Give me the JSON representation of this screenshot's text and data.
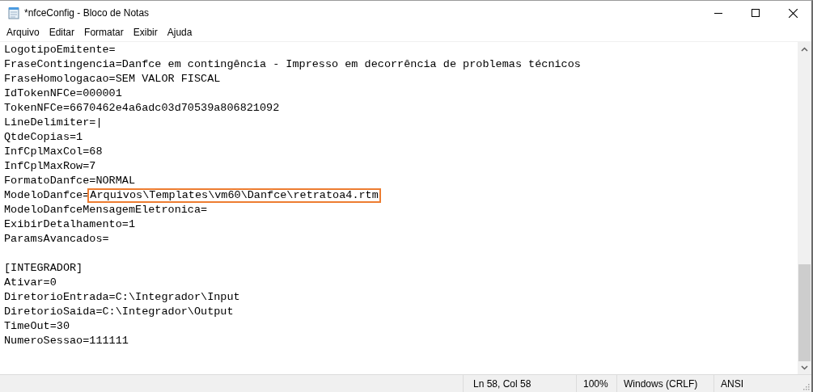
{
  "window": {
    "title": "*nfceConfig - Bloco de Notas"
  },
  "menu": [
    "Arquivo",
    "Editar",
    "Formatar",
    "Exibir",
    "Ajuda"
  ],
  "editor": {
    "sections": [
      {
        "lines": [
          {
            "text": "LogotipoEmitente="
          },
          {
            "text": "FraseContingencia=Danfce em contingência - Impresso em decorrência de problemas técnicos"
          },
          {
            "text": "FraseHomologacao=SEM VALOR FISCAL"
          },
          {
            "text": "IdTokenNFCe=000001"
          },
          {
            "text": "TokenNFCe=6670462e4a6adc03d70539a806821092"
          },
          {
            "text": "LineDelimiter=|"
          },
          {
            "text": "QtdeCopias=1"
          },
          {
            "text": "InfCplMaxCol=68"
          },
          {
            "text": "InfCplMaxRow=7"
          },
          {
            "text": "FormatoDanfce=NORMAL"
          },
          {
            "text": "ModeloDanfce=",
            "highlight": "Arquivos\\Templates\\vm60\\Danfce\\retratoa4.rtm"
          },
          {
            "text": "ModeloDanfceMensagemEletronica="
          },
          {
            "text": "ExibirDetalhamento=1"
          },
          {
            "text": "ParamsAvancados="
          }
        ]
      },
      {
        "lines": [
          {
            "text": "[INTEGRADOR]"
          },
          {
            "text": "Ativar=0"
          },
          {
            "text": "DiretorioEntrada=C:\\Integrador\\Input"
          },
          {
            "text": "DiretorioSaida=C:\\Integrador\\Output"
          },
          {
            "text": "TimeOut=30"
          },
          {
            "text": "NumeroSessao=111111"
          }
        ]
      }
    ]
  },
  "status_bar": {
    "position": "Ln 58, Col 58",
    "zoom": "100%",
    "line_ending": "Windows (CRLF)",
    "encoding": "ANSI"
  }
}
